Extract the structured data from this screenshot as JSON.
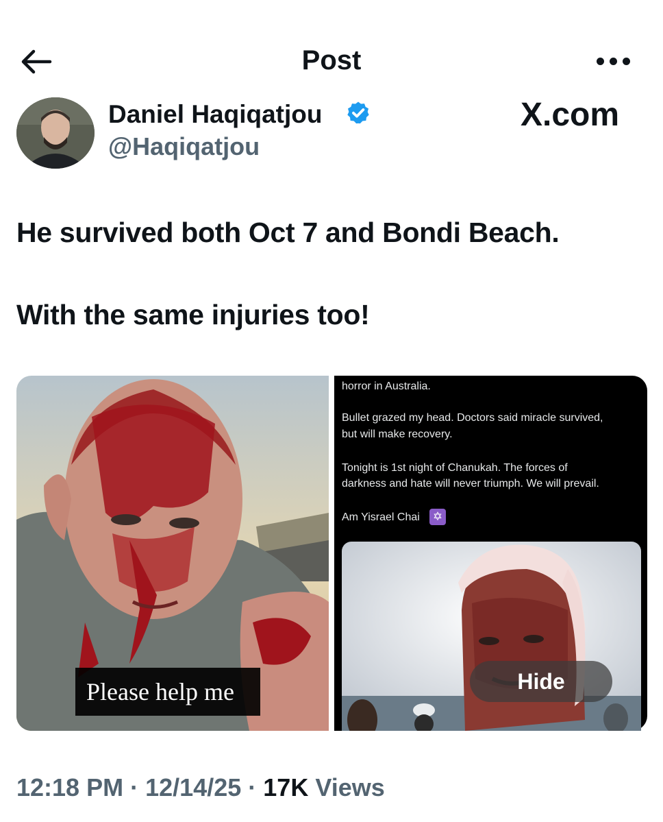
{
  "header": {
    "title": "Post",
    "back_icon": "arrow-left-icon",
    "more_icon": "more-horizontal-icon"
  },
  "author": {
    "name": "Daniel Haqiqatjou",
    "handle": "@Haqiqatjou",
    "verified": true,
    "verified_color": "#1d9bf0"
  },
  "watermark": "X.com",
  "tweet": {
    "lines": [
      "He survived both Oct 7 and Bondi Beach.",
      "With the same injuries too!"
    ]
  },
  "media": {
    "left": {
      "caption": "Please help me"
    },
    "right": {
      "post_lines": [
        "horror in Australia.",
        "Bullet grazed my head. Doctors said miracle survived,",
        "but will make recovery.",
        "Tonight is 1st night of Chanukah. The forces of",
        "darkness and hate will never triumph. We will prevail.",
        "Am Yisrael Chai"
      ],
      "emoji": "✡",
      "hide_label": "Hide"
    }
  },
  "meta": {
    "time": "12:18 PM",
    "date": "12/14/25",
    "views_count": "17K",
    "views_label": "Views",
    "separator": "·"
  },
  "colors": {
    "text": "#0f1419",
    "secondary": "#536471",
    "blood": "#a0141c"
  }
}
